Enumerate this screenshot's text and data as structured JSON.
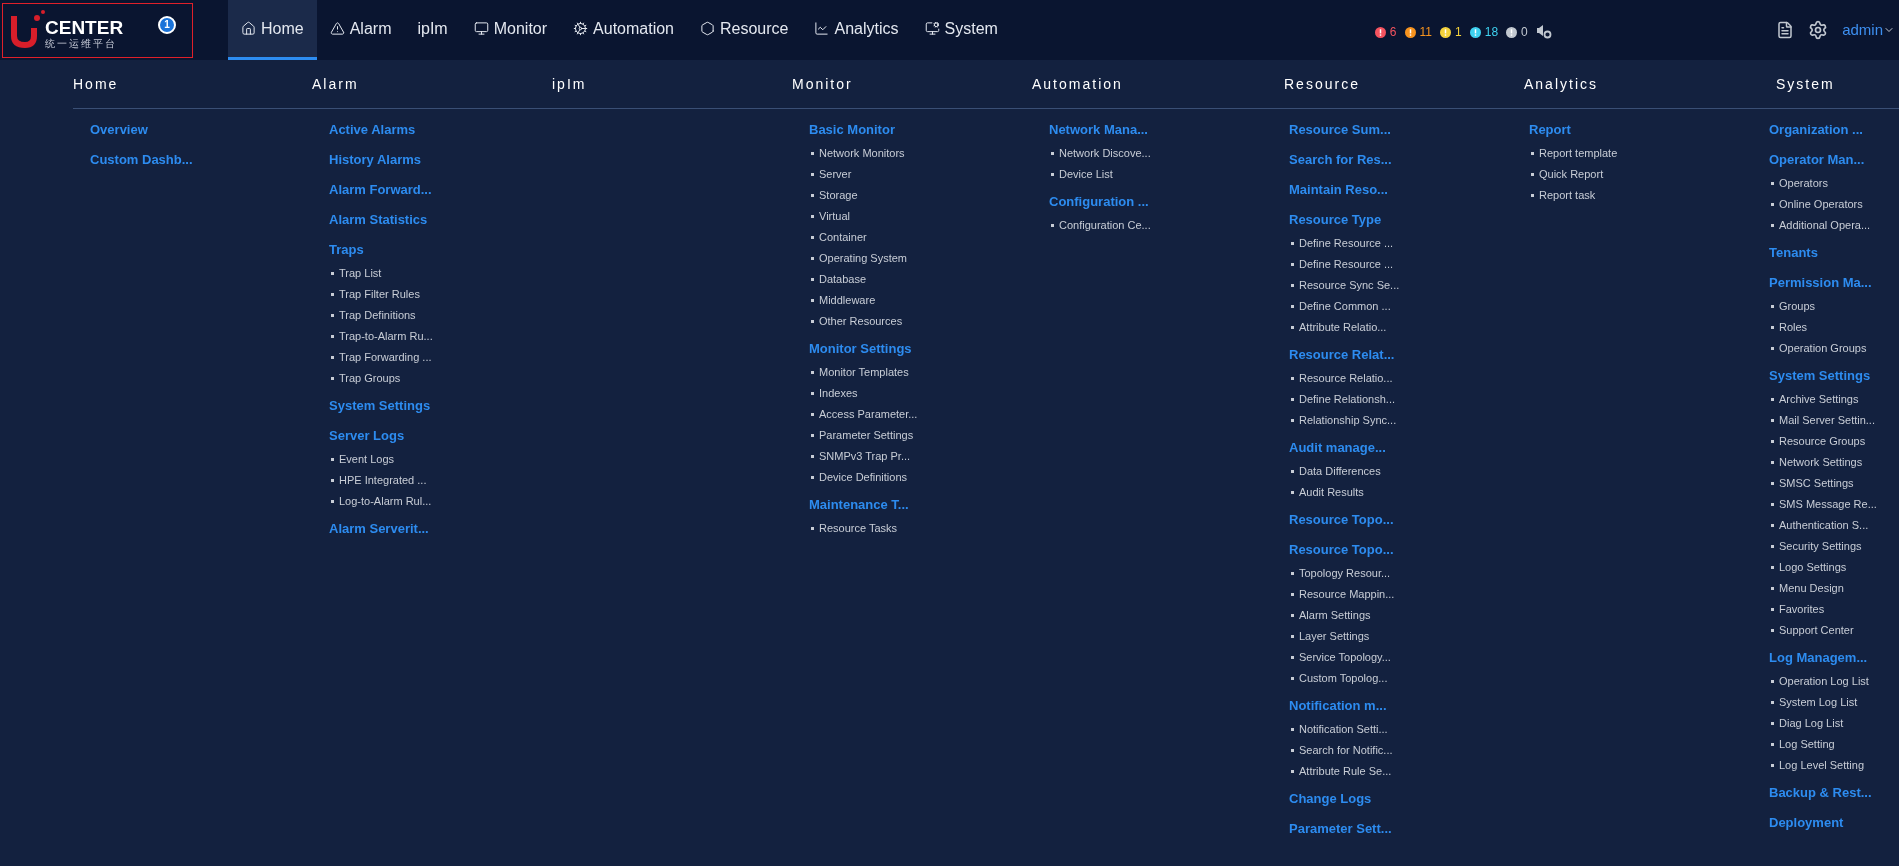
{
  "logo": {
    "text": "CENTER",
    "subtitle": "统一运维平台",
    "badge": "1"
  },
  "nav": [
    {
      "label": "Home",
      "selected": true
    },
    {
      "label": "Alarm",
      "selected": false
    },
    {
      "label": "ipIm",
      "selected": false
    },
    {
      "label": "Monitor",
      "selected": false
    },
    {
      "label": "Automation",
      "selected": false
    },
    {
      "label": "Resource",
      "selected": false
    },
    {
      "label": "Analytics",
      "selected": false
    },
    {
      "label": "System",
      "selected": false
    }
  ],
  "alarm_counts": [
    {
      "count": "6",
      "color": "#f5535f"
    },
    {
      "count": "11",
      "color": "#f7931e"
    },
    {
      "count": "1",
      "color": "#f4d23c"
    },
    {
      "count": "18",
      "color": "#3ed1f0"
    },
    {
      "count": "0",
      "color": "#c2c8d0"
    }
  ],
  "user": "admin",
  "menu": [
    {
      "title": "Home",
      "groups": [
        {
          "title": "Overview"
        },
        {
          "title": "Custom Dashb..."
        }
      ]
    },
    {
      "title": "Alarm",
      "groups": [
        {
          "title": "Active Alarms"
        },
        {
          "title": "History Alarms"
        },
        {
          "title": "Alarm Forward..."
        },
        {
          "title": "Alarm Statistics"
        },
        {
          "title": "Traps",
          "items": [
            "Trap List",
            "Trap Filter Rules",
            "Trap Definitions",
            "Trap-to-Alarm Ru...",
            "Trap Forwarding ...",
            "Trap Groups"
          ]
        },
        {
          "title": "System Settings"
        },
        {
          "title": "Server Logs",
          "items": [
            "Event Logs",
            "HPE Integrated ...",
            "Log-to-Alarm Rul..."
          ]
        },
        {
          "title": "Alarm Serverit..."
        }
      ]
    },
    {
      "title": "ipIm"
    },
    {
      "title": "Monitor",
      "groups": [
        {
          "title": "Basic Monitor",
          "items": [
            "Network Monitors",
            "Server",
            "Storage",
            "Virtual",
            "Container",
            "Operating System",
            "Database",
            "Middleware",
            "Other Resources"
          ]
        },
        {
          "title": "Monitor Settings",
          "items": [
            "Monitor Templates",
            "Indexes",
            "Access Parameter...",
            "Parameter Settings",
            "SNMPv3 Trap Pr...",
            "Device Definitions"
          ]
        },
        {
          "title": "Maintenance T...",
          "items": [
            "Resource Tasks"
          ]
        }
      ]
    },
    {
      "title": "Automation",
      "groups": [
        {
          "title": "Network Mana...",
          "items": [
            "Network Discove...",
            "Device List"
          ]
        },
        {
          "title": "Configuration ...",
          "items": [
            "Configuration Ce..."
          ]
        }
      ]
    },
    {
      "title": "Resource",
      "groups": [
        {
          "title": "Resource Sum..."
        },
        {
          "title": "Search for Res..."
        },
        {
          "title": "Maintain Reso..."
        },
        {
          "title": "Resource Type",
          "items": [
            "Define Resource ...",
            "Define Resource ...",
            "Resource Sync Se...",
            "Define Common ...",
            "Attribute Relatio..."
          ]
        },
        {
          "title": "Resource Relat...",
          "items": [
            "Resource Relatio...",
            "Define Relationsh...",
            "Relationship Sync..."
          ]
        },
        {
          "title": "Audit manage...",
          "items": [
            "Data Differences",
            "Audit Results"
          ]
        },
        {
          "title": "Resource Topo..."
        },
        {
          "title": "Resource Topo...",
          "items": [
            "Topology Resour...",
            "Resource Mappin...",
            "Alarm Settings",
            "Layer Settings",
            "Service Topology...",
            "Custom Topolog..."
          ]
        },
        {
          "title": "Notification m...",
          "items": [
            "Notification Setti...",
            "Search for Notific...",
            "Attribute Rule Se..."
          ]
        },
        {
          "title": "Change Logs"
        },
        {
          "title": "Parameter Sett..."
        }
      ]
    },
    {
      "title": "Analytics",
      "groups": [
        {
          "title": "Report",
          "items": [
            "Report template",
            "Quick Report",
            "Report task"
          ]
        }
      ]
    },
    {
      "title": "System",
      "groups": [
        {
          "title": "Organization ..."
        },
        {
          "title": "Operator Man...",
          "items": [
            "Operators",
            "Online Operators",
            "Additional Opera..."
          ]
        },
        {
          "title": "Tenants"
        },
        {
          "title": "Permission Ma...",
          "items": [
            "Groups",
            "Roles",
            "Operation Groups"
          ]
        },
        {
          "title": "System Settings",
          "items": [
            "Archive Settings",
            "Mail Server Settin...",
            "Resource Groups",
            "Network Settings",
            "SMSC Settings",
            "SMS Message Re...",
            "Authentication S...",
            "Security Settings",
            "Logo Settings",
            "Menu Design",
            "Favorites",
            "Support Center"
          ]
        },
        {
          "title": "Log Managem...",
          "items": [
            "Operation Log List",
            "System Log List",
            "Diag Log List",
            "Log Setting",
            "Log Level Setting"
          ]
        },
        {
          "title": "Backup & Rest..."
        },
        {
          "title": "Deployment"
        }
      ]
    }
  ]
}
